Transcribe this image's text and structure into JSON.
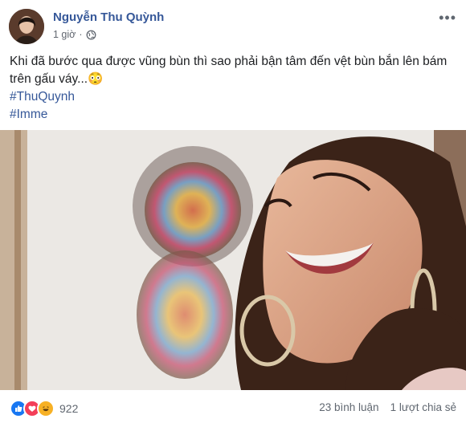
{
  "post": {
    "author": "Nguyễn Thu Quỳnh",
    "time": "1 giờ",
    "privacy_icon": "globe-icon",
    "text": "Khi đã bước qua được vũng bùn thì sao phải bận tâm đến vệt bùn bắn lên bám trên gấu váy...😳",
    "hashtags": [
      "#ThuQuynh",
      "#Imme"
    ]
  },
  "footer": {
    "reaction_icons": [
      "like-icon",
      "love-icon",
      "haha-icon"
    ],
    "reaction_count": "922",
    "comments": "23 bình luận",
    "shares": "1 lượt chia sẻ"
  },
  "colors": {
    "link": "#365899",
    "like": "#1877f2",
    "love": "#f33e58",
    "haha": "#f7b125"
  }
}
